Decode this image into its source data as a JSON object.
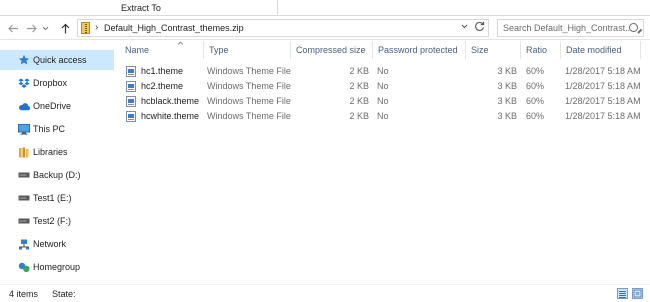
{
  "ribbon": {
    "tab_label": "Extract To"
  },
  "nav": {
    "back_icon": "back-arrow-icon",
    "forward_icon": "forward-arrow-icon",
    "recent_icon": "chevron-down-icon",
    "up_icon": "up-arrow-icon",
    "address": "Default_High_Contrast_themes.zip",
    "search_placeholder": "Search Default_High_Contrast..."
  },
  "sidebar": {
    "items": [
      {
        "label": "Quick access",
        "icon": "star-icon",
        "active": true
      },
      {
        "label": "Dropbox",
        "icon": "dropbox-icon"
      },
      {
        "label": "OneDrive",
        "icon": "cloud-icon"
      },
      {
        "label": "This PC",
        "icon": "monitor-icon"
      },
      {
        "label": "Libraries",
        "icon": "library-icon"
      },
      {
        "label": "Backup (D:)",
        "icon": "drive-icon"
      },
      {
        "label": "Test1 (E:)",
        "icon": "drive-icon"
      },
      {
        "label": "Test2 (F:)",
        "icon": "drive-icon"
      },
      {
        "label": "Network",
        "icon": "network-icon"
      },
      {
        "label": "Homegroup",
        "icon": "homegroup-icon"
      }
    ]
  },
  "table": {
    "columns": [
      "Name",
      "Type",
      "Compressed size",
      "Password protected",
      "Size",
      "Ratio",
      "Date modified"
    ],
    "rows": [
      {
        "name": "hc1.theme",
        "type": "Windows Theme File",
        "compressed": "2 KB",
        "password": "No",
        "size": "3 KB",
        "ratio": "60%",
        "date": "1/28/2017 5:18 AM"
      },
      {
        "name": "hc2.theme",
        "type": "Windows Theme File",
        "compressed": "2 KB",
        "password": "No",
        "size": "3 KB",
        "ratio": "60%",
        "date": "1/28/2017 5:18 AM"
      },
      {
        "name": "hcblack.theme",
        "type": "Windows Theme File",
        "compressed": "2 KB",
        "password": "No",
        "size": "3 KB",
        "ratio": "60%",
        "date": "1/28/2017 5:18 AM"
      },
      {
        "name": "hcwhite.theme",
        "type": "Windows Theme File",
        "compressed": "2 KB",
        "password": "No",
        "size": "3 KB",
        "ratio": "60%",
        "date": "1/28/2017 5:18 AM"
      }
    ]
  },
  "status": {
    "item_count": "4 items",
    "state_label": "State:"
  },
  "colors": {
    "selection": "#cce8ff",
    "header_text": "#4c607a",
    "accent": "#0078d7"
  }
}
